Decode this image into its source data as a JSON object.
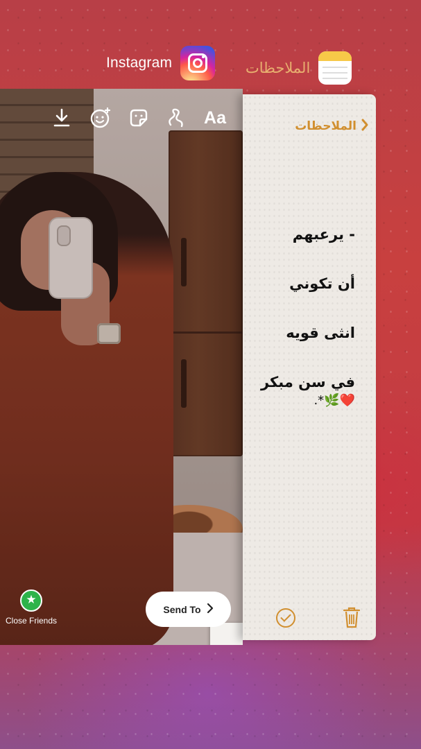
{
  "app_switcher": {
    "instagram": {
      "name": "Instagram",
      "icon": "instagram-icon"
    },
    "notes": {
      "name": "الملاحظات",
      "icon": "notes-app-icon",
      "accent": "#e8b06f"
    }
  },
  "instagram_story": {
    "toolbar": {
      "download_icon": "download-icon",
      "face_effects_icon": "face-sparkle-icon",
      "sticker_icon": "sticker-icon",
      "draw_icon": "draw-squiggle-icon",
      "text_label": "Aa"
    },
    "close_friends": {
      "label": "Close Friends",
      "icon": "star-icon",
      "color": "#2db34a"
    },
    "send_to": {
      "label": "Send To",
      "icon": "chevron-right-icon"
    }
  },
  "notes_app": {
    "back_label": "الملاحظات",
    "accent": "#d18f2f",
    "note_lines": [
      "- يرعبهم",
      "أن تكوني",
      "انثى قويه",
      "في سن مبكر"
    ],
    "note_emoji": "❤️🌿*.",
    "bottom": {
      "check_icon": "checkmark-circle-icon",
      "trash_icon": "trash-icon"
    }
  }
}
